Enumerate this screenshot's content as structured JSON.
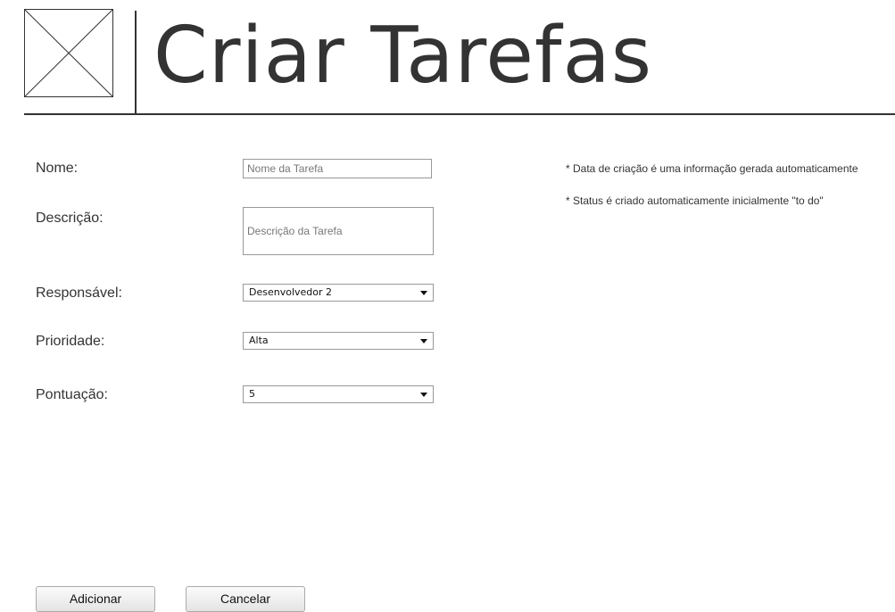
{
  "header": {
    "logo_icon": "image-placeholder-icon",
    "title": "Criar Tarefas"
  },
  "form": {
    "nome": {
      "label": "Nome:",
      "placeholder": "Nome da Tarefa",
      "value": ""
    },
    "descricao": {
      "label": "Descrição:",
      "placeholder": "Descrição da Tarefa"
    },
    "responsavel": {
      "label": "Responsável:",
      "selected": "Desenvolvedor 2"
    },
    "prioridade": {
      "label": "Prioridade:",
      "selected": "Alta"
    },
    "pontuacao": {
      "label": "Pontuação:",
      "selected": "5"
    }
  },
  "notes": [
    "* Data de criação é uma informação gerada automaticamente",
    "* Status é criado automaticamente inicialmente \"to do\""
  ],
  "actions": {
    "add_label": "Adicionar",
    "cancel_label": "Cancelar"
  },
  "colors": {
    "text": "#333333",
    "border": "#999999",
    "button_bg": "#eeeeee"
  }
}
